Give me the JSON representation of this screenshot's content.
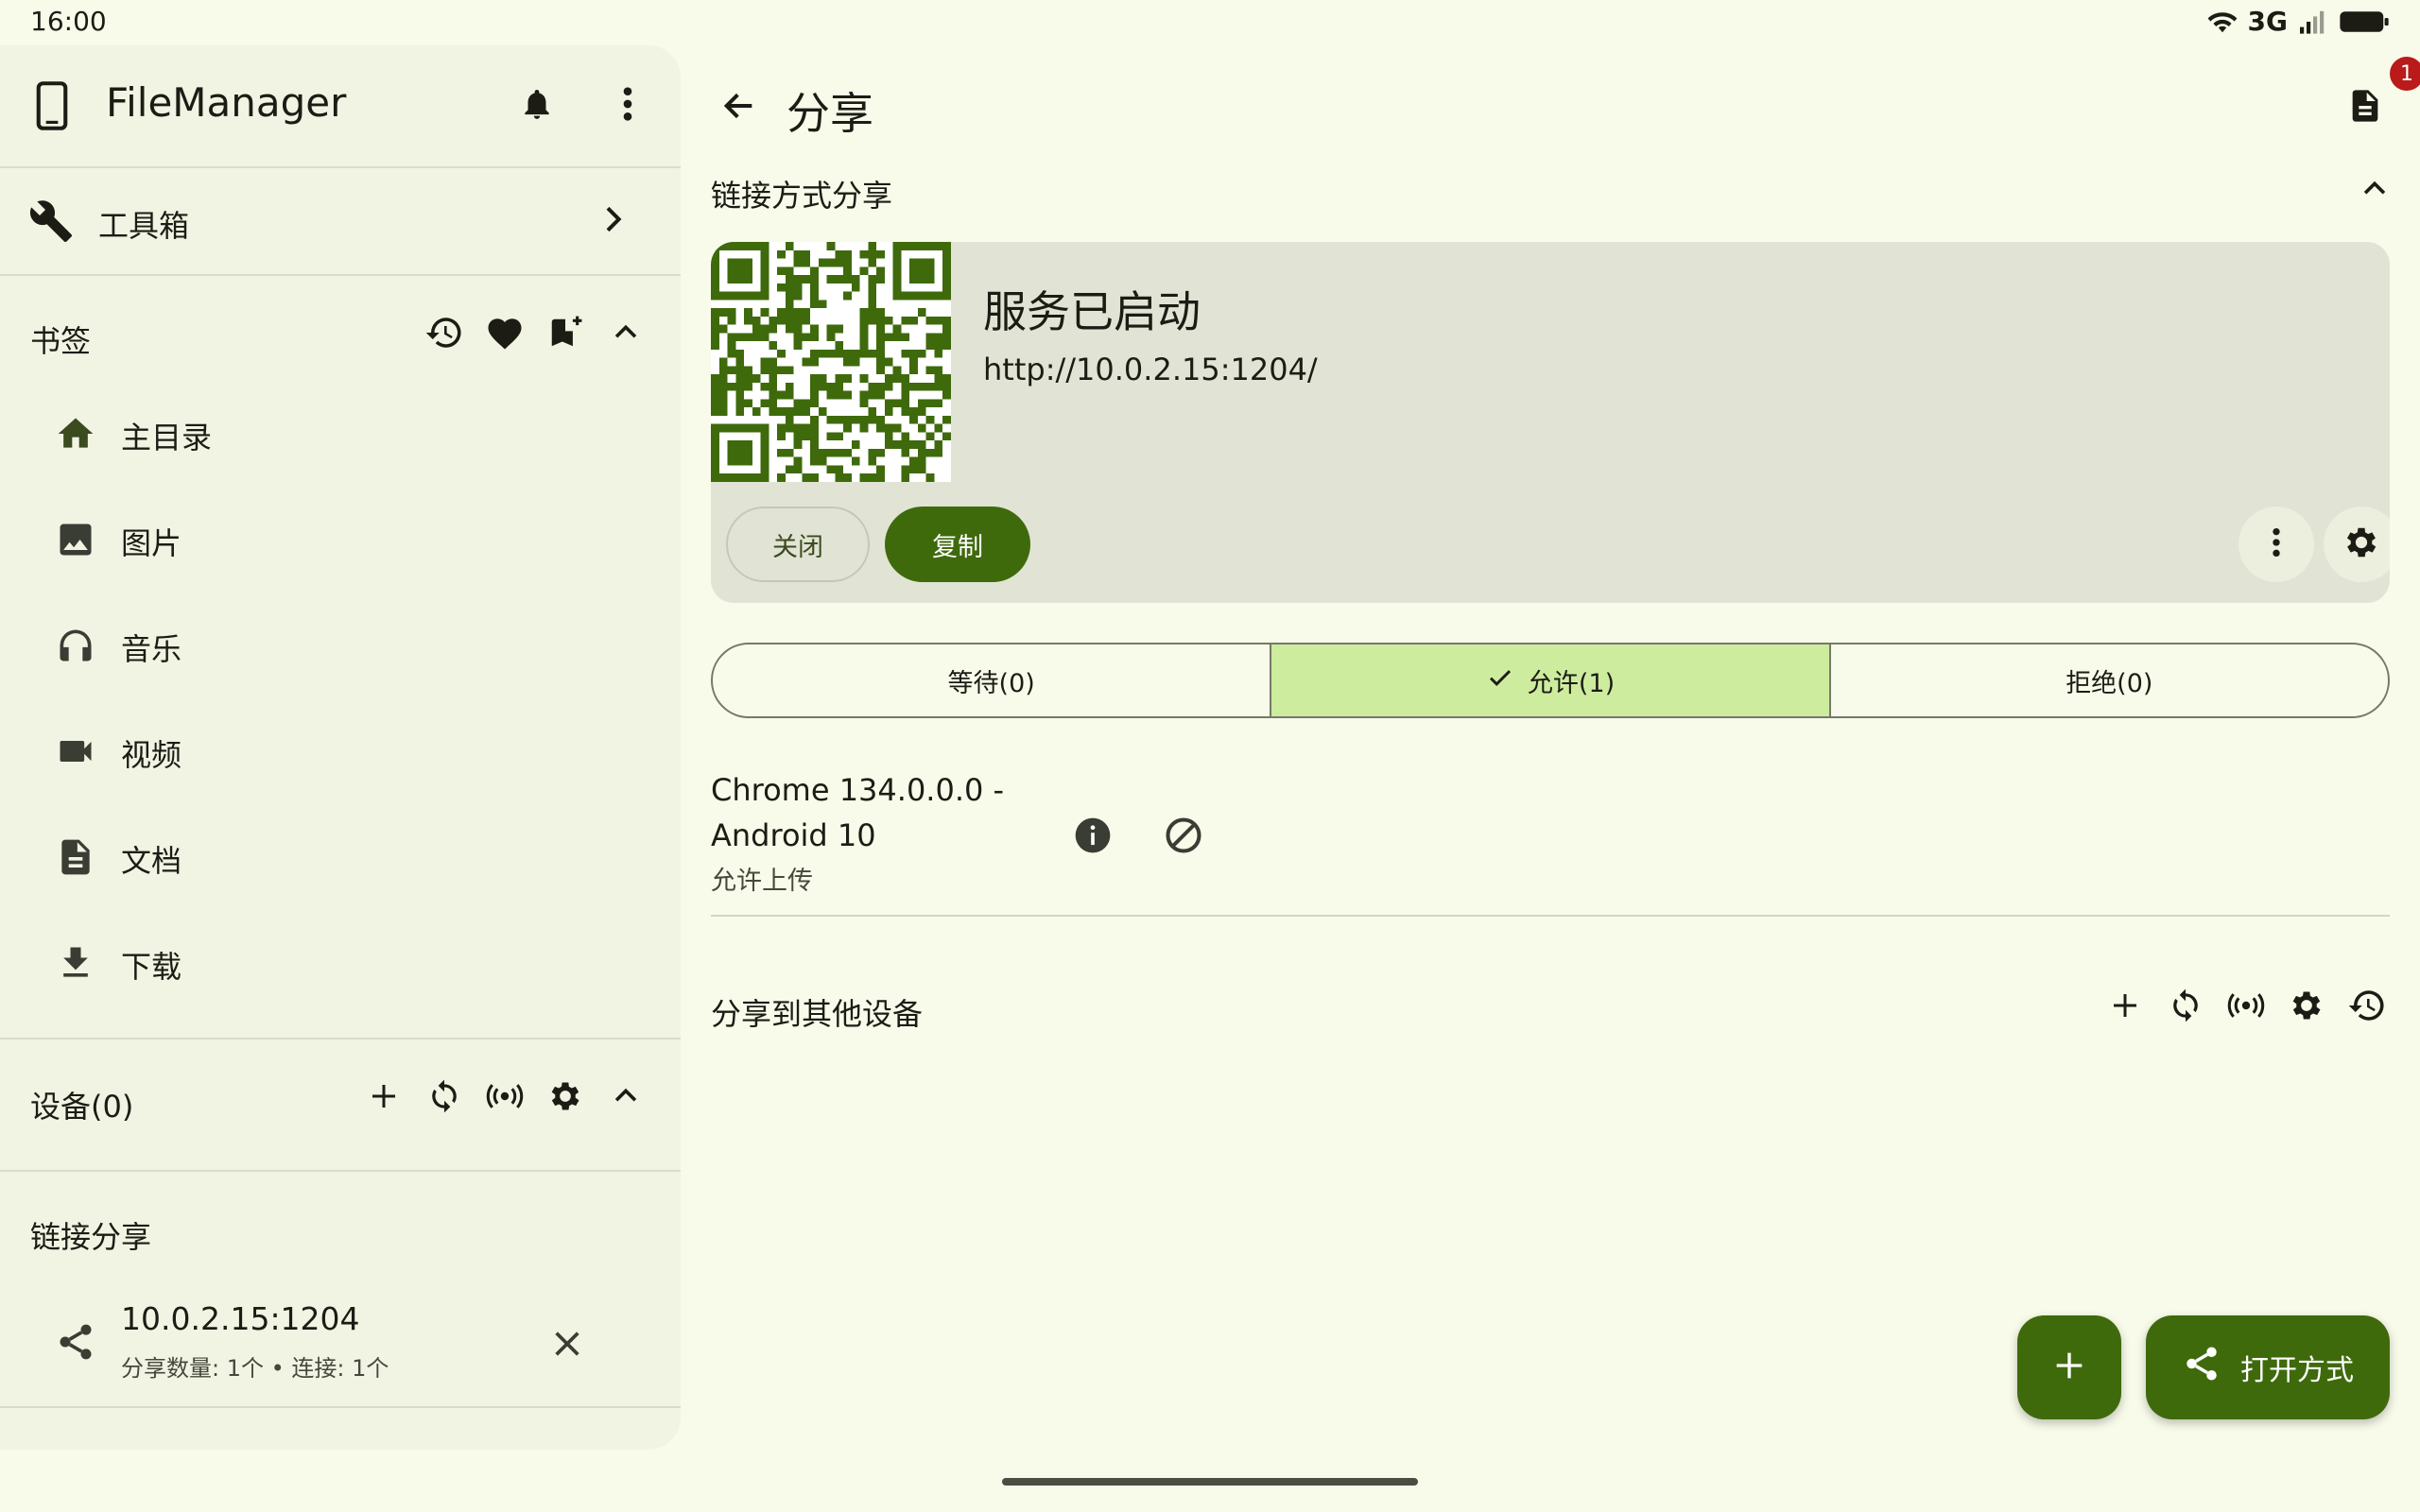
{
  "status_bar": {
    "time": "16:00",
    "network": "3G"
  },
  "drawer": {
    "app_title": "FileManager",
    "toolbox_label": "工具箱",
    "bookmarks_title": "书签",
    "bookmarks": [
      {
        "label": "主目录",
        "icon": "home-icon",
        "active": true
      },
      {
        "label": "图片",
        "icon": "image-icon",
        "active": false
      },
      {
        "label": "音乐",
        "icon": "headphones-icon",
        "active": false
      },
      {
        "label": "视频",
        "icon": "video-icon",
        "active": false
      },
      {
        "label": "文档",
        "icon": "document-icon",
        "active": false
      },
      {
        "label": "下载",
        "icon": "download-icon",
        "active": false
      }
    ],
    "devices_title": "设备(0)",
    "link_share_title": "链接分享",
    "link_item": {
      "address": "10.0.2.15:1204",
      "detail": "分享数量: 1个 • 连接: 1个"
    }
  },
  "main": {
    "title": "分享",
    "notification_badge": "1",
    "link_share_section": "链接方式分享",
    "card": {
      "status": "服务已启动",
      "url": "http://10.0.2.15:1204/",
      "close_label": "关闭",
      "copy_label": "复制"
    },
    "tabs": [
      {
        "label": "等待(0)",
        "active": false
      },
      {
        "label": "允许(1)",
        "active": true
      },
      {
        "label": "拒绝(0)",
        "active": false
      }
    ],
    "client": {
      "name": "Chrome 134.0.0.0 - Android 10",
      "permission": "允许上传"
    },
    "other_devices_title": "分享到其他设备",
    "fab_open_label": "打开方式"
  },
  "colors": {
    "primary": "#3f6a0c",
    "primary_container": "#cdec9e",
    "background": "#f8fbea",
    "drawer_bg": "#f1f4e3",
    "badge": "#ba1a1a"
  }
}
